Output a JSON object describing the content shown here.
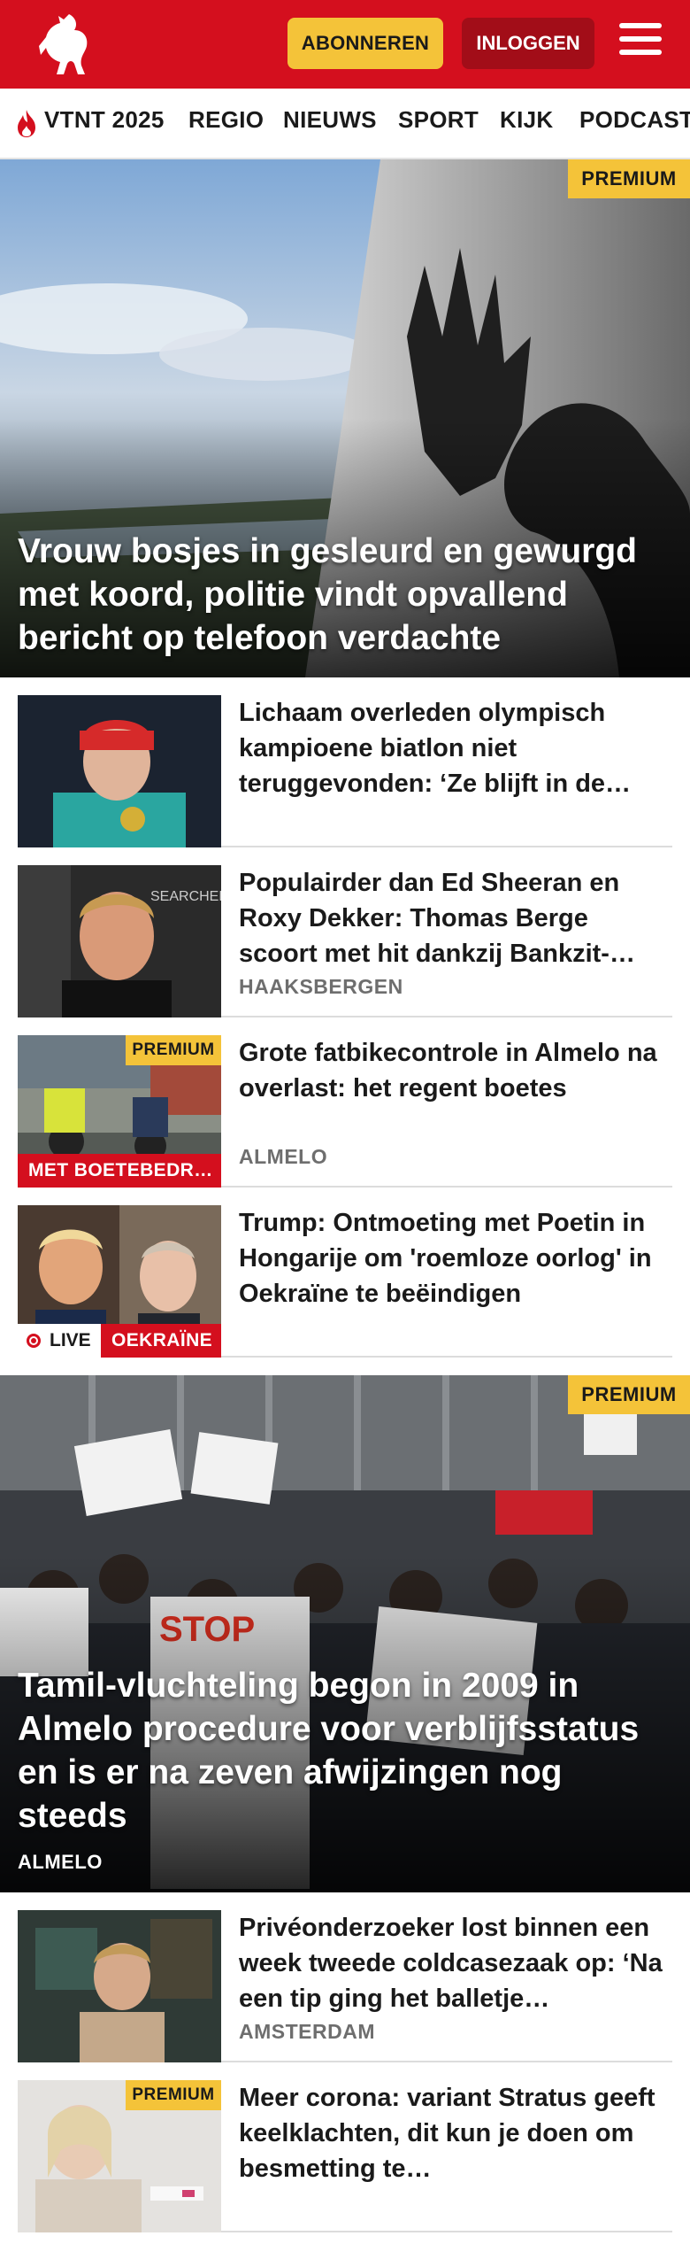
{
  "header": {
    "subscribe_label": "ABONNEREN",
    "login_label": "INLOGGEN",
    "brand_color": "#d40f1e",
    "accent_color": "#f4c339"
  },
  "nav": {
    "items": [
      "VTNT 2025",
      "REGIO",
      "NIEUWS",
      "SPORT",
      "KIJK",
      "PODCAST"
    ]
  },
  "hero1": {
    "badge": "PREMIUM",
    "title": "Vrouw bosjes in gesleurd en gewurgd met koord, politie vindt opvallend bericht op telefoon verdachte"
  },
  "articles1": [
    {
      "title": "Lichaam overleden olympisch kampioene biatlon niet teruggevonden: ‘Ze blijft in de…",
      "tag": ""
    },
    {
      "title": "Populairder dan Ed Sheeran en Roxy Dekker: Thomas Berge scoort met hit dankzij Bankzit-…",
      "tag": "HAAKSBERGEN"
    },
    {
      "title": "Grote fatbikecontrole in Almelo na overlast: het regent boetes",
      "tag": "ALMELO",
      "badge": "PREMIUM",
      "label": "MET BOETEBEDR…"
    },
    {
      "title": "Trump: Ontmoeting met Poetin in Hongarije om 'roemloze oorlog' in Oekraïne te beëindigen",
      "tag": "",
      "live": "LIVE",
      "label": "OEKRAÏNE"
    }
  ],
  "hero2": {
    "badge": "PREMIUM",
    "title": "Tamil-vluchteling begon in 2009 in Almelo procedure voor verblijfsstatus en is er na zeven afwijzingen nog steeds",
    "tag": "ALMELO"
  },
  "articles2": [
    {
      "title": "Privéonderzoeker lost binnen een week tweede coldcasezaak op: ‘Na een tip ging het balletje…",
      "tag": "AMSTERDAM"
    },
    {
      "title": "Meer corona: variant Stratus geeft keelklachten, dit kun je doen om besmetting te…",
      "tag": "",
      "badge": "PREMIUM"
    }
  ]
}
